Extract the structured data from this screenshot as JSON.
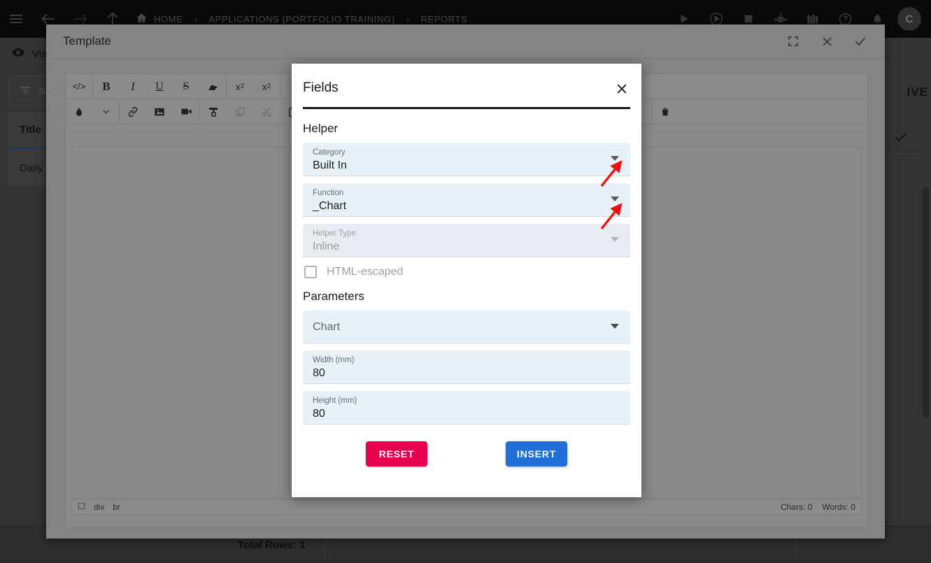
{
  "topbar": {
    "menu_icon": "hamburger-icon",
    "back_icon": "arrow-left-icon",
    "forward_icon": "arrow-right-icon",
    "up_icon": "arrow-up-icon",
    "home_icon": "home-icon",
    "breadcrumbs": [
      {
        "label": "HOME"
      },
      {
        "label": "APPLICATIONS (PORTFOLIO TRAINING)"
      },
      {
        "label": "REPORTS"
      }
    ],
    "separator": "›",
    "right_icons": [
      "play-icon",
      "play-circle-icon",
      "stop-icon",
      "robot-icon",
      "library-icon",
      "help-icon",
      "bell-icon"
    ],
    "avatar_label": "C"
  },
  "left_panel": {
    "visible_label": "Vis",
    "eye_icon": "eye-icon",
    "filter_icon": "filter-icon",
    "search_placeholder": "Se",
    "column_header": "Title",
    "rows": [
      {
        "title": "Daily V"
      }
    ]
  },
  "right_panel": {
    "archive_label": "IVE",
    "check_icon": "check-icon"
  },
  "footer": {
    "total_rows": "Total Rows: 1"
  },
  "template_modal": {
    "title": "Template",
    "fullscreen_icon": "fullscreen-icon",
    "close_icon": "close-icon",
    "confirm_icon": "check-icon",
    "toolbar_row1": [
      "code-icon",
      "bold-icon",
      "italic-icon",
      "underline-icon",
      "strikethrough-icon",
      "eraser-icon",
      "superscript-icon",
      "subscript-icon"
    ],
    "toolbar_row1_labels": [
      "</>",
      "B",
      "I",
      "U",
      "S",
      "",
      "x²",
      "x₂"
    ],
    "toolbar_row2": [
      "color-drop-icon",
      "chevron-down-icon",
      "link-icon",
      "image-icon",
      "video-icon",
      "format-painter-icon",
      "copy-icon",
      "cut-icon",
      "paste-icon",
      "trash-icon"
    ],
    "status_path": [
      "div",
      "br"
    ],
    "status_chars": "Chars: 0",
    "status_words": "Words: 0"
  },
  "fields_dialog": {
    "title": "Fields",
    "close_icon": "close-icon",
    "helper_section": "Helper",
    "category": {
      "label": "Category",
      "value": "Built In"
    },
    "function": {
      "label": "Function",
      "value": "_Chart"
    },
    "helper_type": {
      "label": "Helper Type",
      "value": "Inline"
    },
    "html_escaped": {
      "label": "HTML-escaped",
      "checked": false
    },
    "parameters_section": "Parameters",
    "chart_select": {
      "placeholder": "Chart"
    },
    "width": {
      "label": "Width (mm)",
      "value": "80"
    },
    "height": {
      "label": "Height (mm)",
      "value": "80"
    },
    "reset_button": "RESET",
    "insert_button": "INSERT",
    "colors": {
      "reset": "#e6004f",
      "insert": "#1f6fd6",
      "field_bg": "#e8f0f8",
      "annotation_arrow": "#ee1111"
    }
  }
}
